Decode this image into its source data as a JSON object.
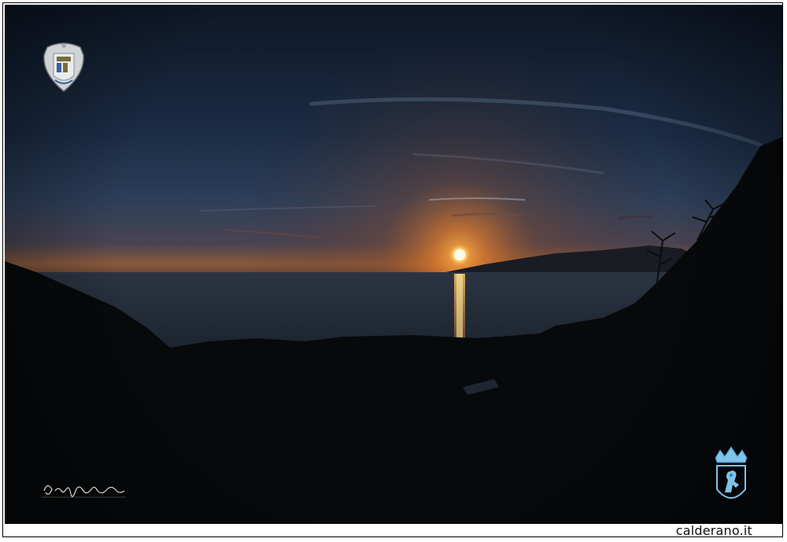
{
  "footer": {
    "site": "calderano.it"
  },
  "photo": {
    "subject": "sunset-over-sea",
    "colors": {
      "sky_top": "#1b2c45",
      "sky_glow": "#d9742a",
      "sun": "#fff1b0",
      "sea": "#2a3444",
      "land": "#07090b"
    }
  },
  "marks": {
    "crest_top": "coat-of-arms",
    "crest_bottom": "crowned-lion-crest",
    "signature": "handwritten-signature"
  }
}
